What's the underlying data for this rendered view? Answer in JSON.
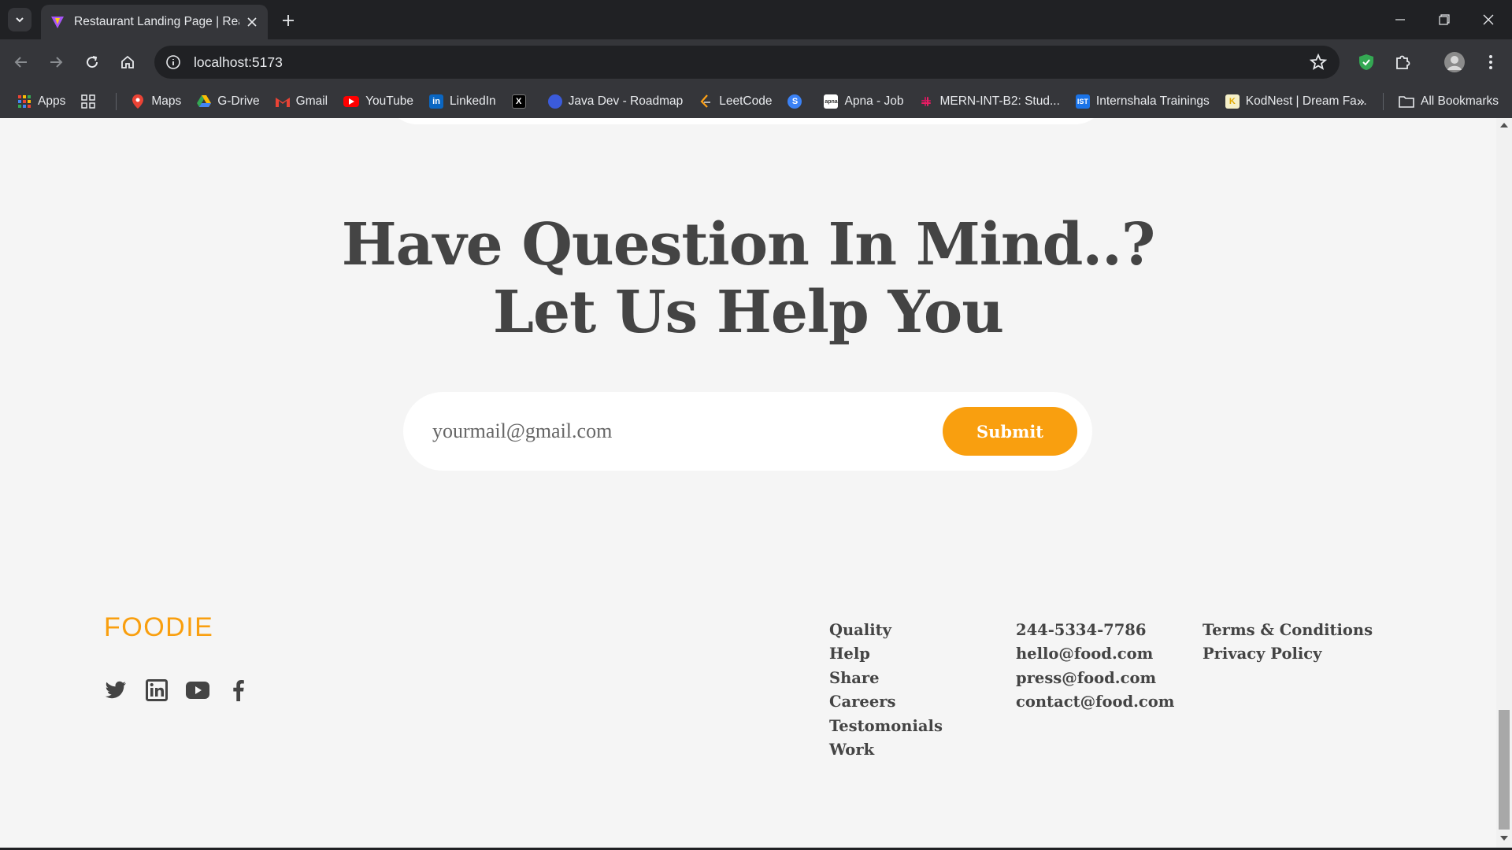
{
  "browser": {
    "tab_title": "Restaurant Landing Page | React",
    "url": "localhost:5173",
    "bookmarks": [
      {
        "label": "Apps",
        "icon": "apps-grid-icon"
      },
      {
        "label": "",
        "icon": "grid-icon"
      },
      {
        "label": "Maps",
        "icon": "maps-icon"
      },
      {
        "label": "G-Drive",
        "icon": "drive-icon"
      },
      {
        "label": "Gmail",
        "icon": "gmail-icon"
      },
      {
        "label": "YouTube",
        "icon": "youtube-icon"
      },
      {
        "label": "LinkedIn",
        "icon": "linkedin-icon"
      },
      {
        "label": "",
        "icon": "x-icon"
      },
      {
        "label": "Java Dev - Roadmap",
        "icon": "roadmap-icon"
      },
      {
        "label": "LeetCode",
        "icon": "leetcode-icon"
      },
      {
        "label": "",
        "icon": "s-icon"
      },
      {
        "label": "Apna - Job",
        "icon": "apna-icon"
      },
      {
        "label": "MERN-INT-B2: Stud...",
        "icon": "slack-icon"
      },
      {
        "label": "Internshala Trainings",
        "icon": "ist-icon"
      },
      {
        "label": "KodNest | Dream Fa...",
        "icon": "kodnest-icon"
      }
    ],
    "all_bookmarks_label": "All Bookmarks"
  },
  "page": {
    "headline_line1": "Have Question In Mind..?",
    "headline_line2": "Let Us Help You",
    "email_placeholder": "yourmail@gmail.com",
    "submit_label": "Submit",
    "brand": "FOODIE",
    "footer_col1": [
      "Quality",
      "Help",
      "Share",
      "Careers",
      "Testomonials",
      "Work"
    ],
    "footer_col2": [
      "244-5334-7786",
      "hello@food.com",
      "press@food.com",
      "contact@food.com"
    ],
    "footer_col3": [
      "Terms & Conditions",
      "Privacy Policy"
    ],
    "socials": [
      "twitter-icon",
      "linkedin-icon",
      "youtube-icon",
      "facebook-icon"
    ]
  },
  "colors": {
    "accent": "#f99f0f",
    "heading": "#444444",
    "background": "#f5f5f5"
  }
}
